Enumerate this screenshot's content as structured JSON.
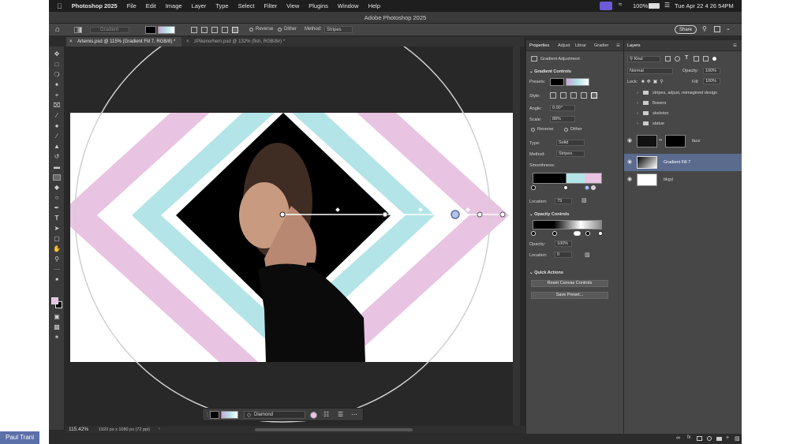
{
  "menubar": {
    "app": "Photoshop 2025",
    "items": [
      "File",
      "Edit",
      "Image",
      "Layer",
      "Type",
      "Select",
      "Filter",
      "View",
      "Plugins",
      "Window",
      "Help"
    ],
    "battery": "100%",
    "datetime": "Tue Apr 22  4 26 54PM"
  },
  "window_title": "Adobe Photoshop 2025",
  "options": {
    "preset": "Gradient",
    "reverse_label": "Reverse",
    "dither_label": "Dither",
    "method_label": "Method:",
    "method_value": "Stripes",
    "share_label": "Share"
  },
  "tabs": [
    {
      "label": "Artemis.psd @ 115% (Gradient Fill 7, RGB/8) *"
    },
    {
      "label": "zPikenorhern.psd @ 132% (fish, RGB/8#) *"
    }
  ],
  "status": {
    "zoom": "115.42%",
    "dims": "1920 px x 1080 px (72 ppi)"
  },
  "context_bar": {
    "type": "Diamond"
  },
  "badge": "Paul Trani",
  "colors": {
    "pink": "#e8c3e2",
    "cyan": "#b3e4e8",
    "accent_blue": "#5b6fa8"
  },
  "properties": {
    "tabs": [
      "Properties",
      "Adjust",
      "Librar",
      "Gradier"
    ],
    "header": "Gradient Adjustment",
    "gradient_controls": "Gradient Controls",
    "presets_label": "Presets:",
    "style_label": "Style:",
    "angle_label": "Angle:",
    "angle_value": "0.00°",
    "scale_label": "Scale:",
    "scale_value": "88%",
    "reverse_label": "Reverse",
    "dither_label": "Dither",
    "type_label": "Type:",
    "type_value": "Solid",
    "method_label": "Method:",
    "method_value": "Stripes",
    "smoothness_label": "Smoothness:",
    "location_label": "Location:",
    "location_value": "79",
    "opacity_controls": "Opacity Controls",
    "opacity_label": "Opacity:",
    "opacity_value": "100%",
    "location2_label": "Location:",
    "location2_value": "0",
    "quick_actions": "Quick Actions",
    "reset_button": "Reset Canvas Controls",
    "save_button": "Save Preset..."
  },
  "layers": {
    "tab": "Layers",
    "kind": "Kind",
    "blend": "Normal",
    "opacity_label": "Opacity:",
    "opacity_value": "100%",
    "lock_label": "Lock:",
    "fill_label": "Fill:",
    "fill_value": "100%",
    "groups": [
      "stripes, adjust, reimagined design",
      "flowers",
      "skeleton",
      "statue"
    ],
    "face": "face",
    "gradient": "Gradient Fill 7",
    "bkgd": "bkgd"
  }
}
